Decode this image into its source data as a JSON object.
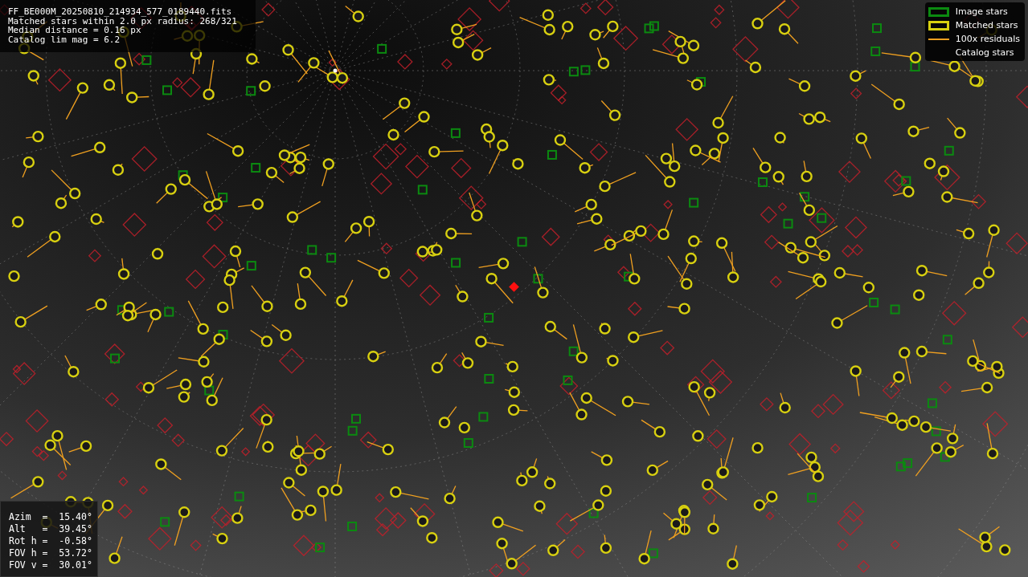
{
  "info_box": {
    "lines": [
      "FF_BE000M_20250810_214934_577_0189440.fits",
      "Matched stars within 2.0 px radius: 268/321",
      "Median distance = 0.16 px",
      "Catalog lim mag = 6.2"
    ]
  },
  "legend": [
    {
      "label": "Image stars",
      "kind": "image"
    },
    {
      "label": "Matched stars",
      "kind": "matched"
    },
    {
      "label": "100x residuals",
      "kind": "residual"
    },
    {
      "label": "Catalog stars",
      "kind": "catalog"
    }
  ],
  "pointing_box": {
    "lines": [
      "Azim  =  15.40°",
      "Alt   =  39.45°",
      "Rot h =  -0.58°",
      "FOV h =  53.72°",
      "FOV v =  30.01°"
    ]
  }
}
